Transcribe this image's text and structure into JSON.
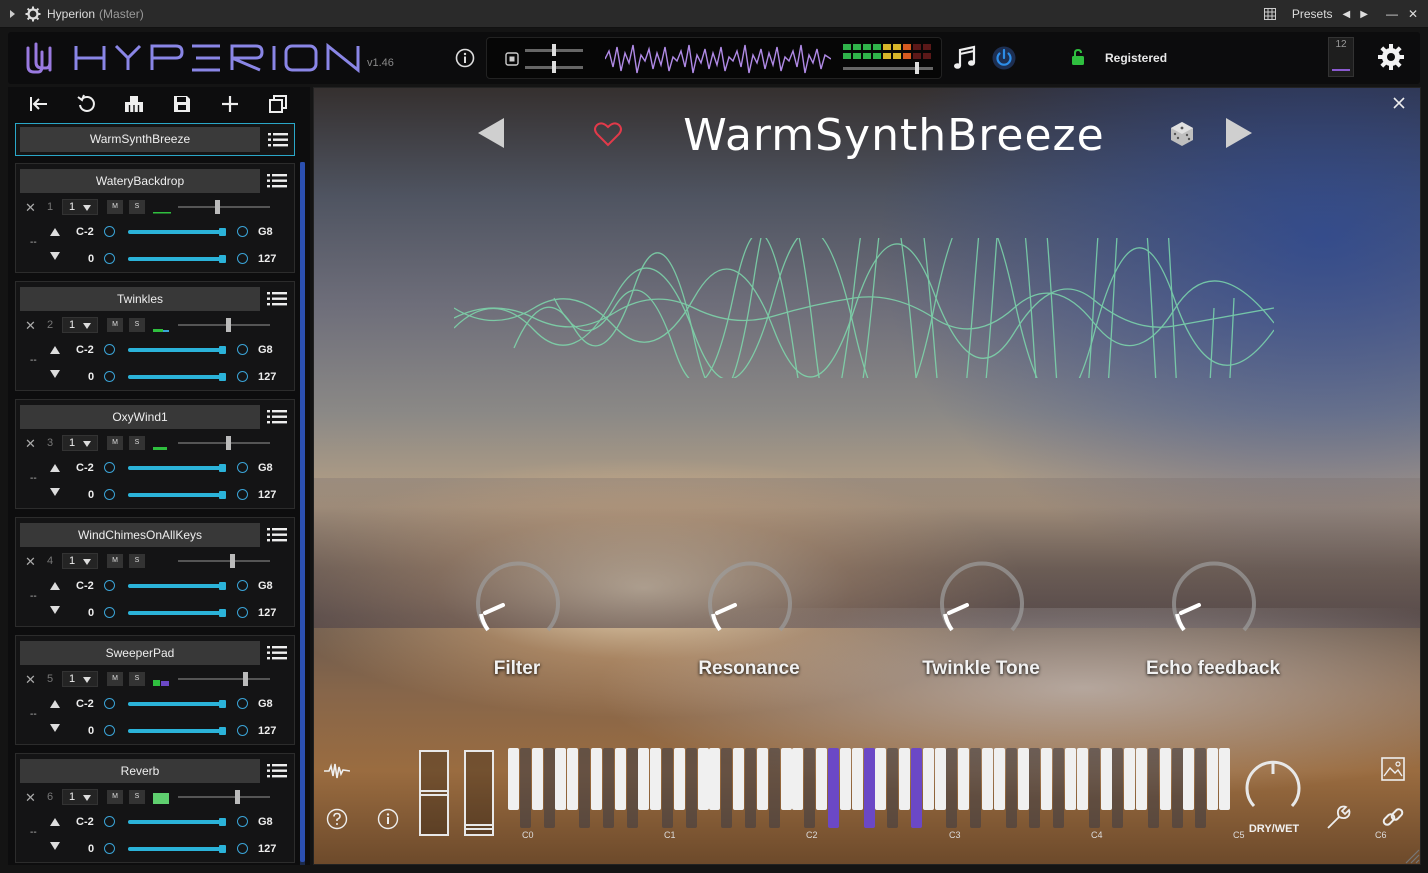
{
  "window": {
    "title": "Hyperion",
    "subtitle": "(Master)",
    "presets_label": "Presets"
  },
  "header": {
    "version": "v1.46",
    "registered": "Registered",
    "counter": "12"
  },
  "sidebar": {
    "current_preset": "WarmSynthBreeze",
    "layers": [
      {
        "name": "WateryBackdrop",
        "index": "1",
        "channel": "1",
        "low_note": "C-2",
        "high_note": "G8",
        "low_vel": "0",
        "high_vel": "127",
        "volume": 0.42
      },
      {
        "name": "Twinkles",
        "index": "2",
        "channel": "1",
        "low_note": "C-2",
        "high_note": "G8",
        "low_vel": "0",
        "high_vel": "127",
        "volume": 0.55
      },
      {
        "name": "OxyWind1",
        "index": "3",
        "channel": "1",
        "low_note": "C-2",
        "high_note": "G8",
        "low_vel": "0",
        "high_vel": "127",
        "volume": 0.55
      },
      {
        "name": "WindChimesOnAllKeys",
        "index": "4",
        "channel": "1",
        "low_note": "C-2",
        "high_note": "G8",
        "low_vel": "0",
        "high_vel": "127",
        "volume": 0.6
      },
      {
        "name": "SweeperPad",
        "index": "5",
        "channel": "1",
        "low_note": "C-2",
        "high_note": "G8",
        "low_vel": "0",
        "high_vel": "127",
        "volume": 0.75
      },
      {
        "name": "Reverb",
        "index": "6",
        "channel": "1",
        "low_note": "C-2",
        "high_note": "G8",
        "low_vel": "0",
        "high_vel": "127",
        "volume": 0.65
      }
    ],
    "mute_label": "M",
    "solo_label": "S"
  },
  "stage": {
    "preset_title": "WarmSynthBreeze",
    "macros": [
      "Filter",
      "Resonance",
      "Twinkle Tone",
      "Echo feedback"
    ],
    "drywet_label": "DRY/WET",
    "octave_labels": [
      "C0",
      "C1",
      "C2",
      "C3",
      "C4",
      "C5",
      "C6"
    ]
  },
  "colors": {
    "accent": "#2aa7c8",
    "active_key": "#6b48c6",
    "wave": "#7fe0b0",
    "logo": "#9a7ae0"
  }
}
